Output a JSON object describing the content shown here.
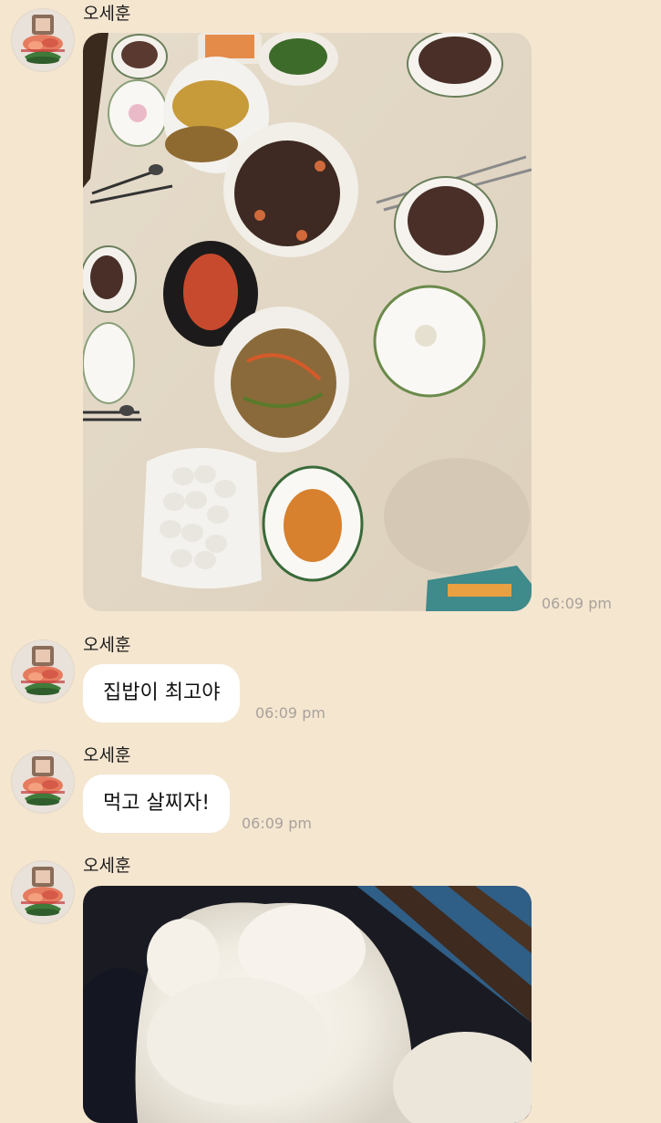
{
  "messages": [
    {
      "sender": "오세훈",
      "type": "photo",
      "photo_subject": "home-cooked-meal",
      "time": "06:09 pm"
    },
    {
      "sender": "오세훈",
      "type": "text",
      "text": "집밥이 최고야",
      "time": "06:09 pm"
    },
    {
      "sender": "오세훈",
      "type": "text",
      "text": "먹고 살찌자!",
      "time": "06:09 pm"
    },
    {
      "sender": "오세훈",
      "type": "photo",
      "photo_subject": "white-fluffy-dog"
    }
  ],
  "colors": {
    "background": "#f5e6d0",
    "bubble": "#ffffff",
    "timestamp": "#a8a29b",
    "table": "#e9dfcf"
  }
}
